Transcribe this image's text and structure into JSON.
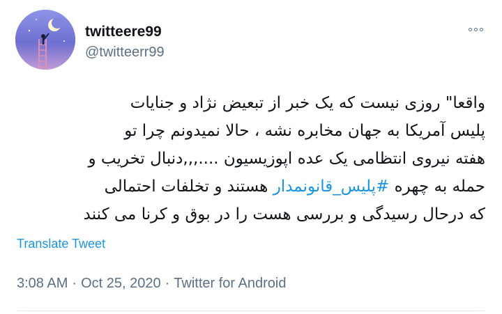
{
  "profile": {
    "display_name": "twitteere99",
    "handle": "@twitteerr99"
  },
  "tweet": {
    "lines": [
      "واقعا\" روزی نیست که یک خبر از تبعیض نژاد و جنایات",
      "پلیس آمریکا به جهان مخابره نشه ، حالا نمیدونم چرا تو",
      "هفته نیروی انتظامی یک عده اپوزیسیون ....,,,دنبال تخریب و",
      "",
      "که درحال رسیدگی و بررسی هست را در بوق و کرنا می کنند"
    ],
    "line4_before": "حمله به چهره ",
    "hashtag": "#پلیس_قانونمدار",
    "line4_after": " هستند و تخلفات احتمالی",
    "translate_label": "Translate Tweet"
  },
  "meta": {
    "time": "3:08 AM",
    "date": "Oct 25, 2020",
    "source": "Twitter for Android",
    "separator": "·"
  },
  "icons": {
    "more": "more-options-icon",
    "avatar": "moon-ladder-avatar"
  },
  "colors": {
    "link": "#1b95e0",
    "secondary_text": "#5b7083",
    "primary_text": "#0f1419",
    "divider": "#e1e8ed"
  }
}
